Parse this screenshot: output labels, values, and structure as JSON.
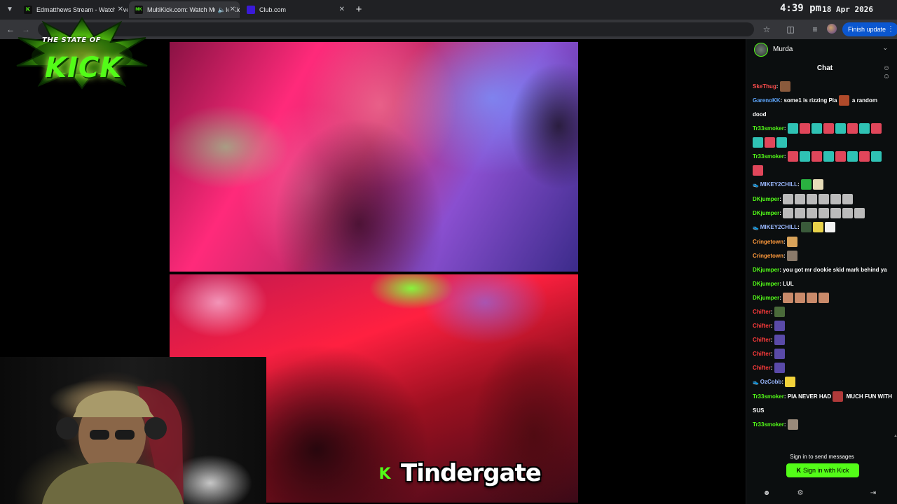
{
  "browser": {
    "tabs": [
      {
        "title": "Edmatthews Stream - Watch Live on Kick",
        "favicon": "K",
        "favicon_color": "#53fc18",
        "active": false
      },
      {
        "title": "MultiKick.com: Watch Multiple Kick Streams",
        "favicon": "MK",
        "favicon_color": "#53fc18",
        "active": true
      },
      {
        "title": "Club.com",
        "favicon": "",
        "favicon_color": "#3a1ad8",
        "active": false
      }
    ],
    "clock": "4:39 pm",
    "date": "18 Apr 2026",
    "finish_update_label": "Finish update"
  },
  "logo": {
    "line1": "THE STATE OF",
    "line2": "KICK"
  },
  "caption": {
    "icon": "K",
    "text": "Tindergate"
  },
  "chat": {
    "channel_name": "Murda",
    "title": "Chat",
    "sign_in_prompt": "Sign in to send messages",
    "sign_in_button": "Sign in with Kick",
    "messages": [
      {
        "user": "SkeThug",
        "color": "#ff4d4d",
        "text": "",
        "emotes": [
          "#8a5a3c"
        ]
      },
      {
        "user": "GarenoKK",
        "color": "#5fa8ff",
        "text": "some1 is rizzing Pia",
        "text2": "a random dood",
        "emotes_mid": [
          "#b04a2a"
        ]
      },
      {
        "user": "Tr33smoker",
        "color": "#53fc18",
        "text": "",
        "emotes": [
          "#2fc2b4",
          "#e0465a",
          "#2fc2b4",
          "#e0465a",
          "#2fc2b4",
          "#e0465a",
          "#2fc2b4",
          "#e0465a",
          "#2fc2b4",
          "#e0465a",
          "#2fc2b4"
        ]
      },
      {
        "user": "Tr33smoker",
        "color": "#53fc18",
        "text": "",
        "emotes": [
          "#e0465a",
          "#2fc2b4",
          "#e0465a",
          "#2fc2b4",
          "#e0465a",
          "#2fc2b4",
          "#e0465a",
          "#2fc2b4",
          "#e0465a"
        ]
      },
      {
        "user": "MIKEY2CHILL",
        "color": "#9ab8ff",
        "badge": "👟",
        "text": "",
        "emotes": [
          "#2ab040",
          "#e6dcb8"
        ]
      },
      {
        "user": "DKjumper",
        "color": "#53fc18",
        "text": "",
        "emotes": [
          "#bbbbbb",
          "#bbbbbb",
          "#bbbbbb",
          "#bbbbbb",
          "#bbbbbb",
          "#bbbbbb"
        ]
      },
      {
        "user": "DKjumper",
        "color": "#53fc18",
        "text": "",
        "emotes": [
          "#bbbbbb",
          "#bbbbbb",
          "#bbbbbb",
          "#bbbbbb",
          "#bbbbbb",
          "#bbbbbb",
          "#bbbbbb"
        ]
      },
      {
        "user": "MIKEY2CHILL",
        "color": "#9ab8ff",
        "badge": "👟",
        "text": "",
        "emotes": [
          "#3a5a3a",
          "#e8d24a",
          "#f2f2f2"
        ]
      },
      {
        "user": "Cringetown",
        "color": "#ff9a3c",
        "text": "",
        "emotes": [
          "#d9a35a"
        ]
      },
      {
        "user": "Cringetown",
        "color": "#ff9a3c",
        "text": "",
        "emotes": [
          "#8a7a6a"
        ]
      },
      {
        "user": "DKjumper",
        "color": "#53fc18",
        "text": "you got mr dookie skid mark behind ya",
        "emotes": []
      },
      {
        "user": "DKjumper",
        "color": "#53fc18",
        "text": "LUL",
        "emotes": []
      },
      {
        "user": "DKjumper",
        "color": "#53fc18",
        "text": "",
        "emotes": [
          "#c98a6a",
          "#c98a6a",
          "#c98a6a",
          "#c98a6a"
        ]
      },
      {
        "user": "Chifter",
        "color": "#ff3b3b",
        "text": "",
        "emotes": [
          "#4a6a3a"
        ]
      },
      {
        "user": "Chifter",
        "color": "#ff3b3b",
        "text": "",
        "emotes": [
          "#5a4aa8"
        ]
      },
      {
        "user": "Chifter",
        "color": "#ff3b3b",
        "text": "",
        "emotes": [
          "#5a4aa8"
        ]
      },
      {
        "user": "Chifter",
        "color": "#ff3b3b",
        "text": "",
        "emotes": [
          "#5a4aa8"
        ]
      },
      {
        "user": "Chifter",
        "color": "#ff3b3b",
        "text": "",
        "emotes": [
          "#5a4aa8"
        ]
      },
      {
        "user": "OzCobb",
        "color": "#9ab8ff",
        "badge": "👟",
        "text": "",
        "emotes": [
          "#f2d23a"
        ]
      },
      {
        "user": "Tr33smoker",
        "color": "#53fc18",
        "text": "PIA NEVER HAD",
        "text2": "MUCH FUN WITH SUS",
        "emotes_mid": [
          "#b03a3a"
        ]
      },
      {
        "user": "Tr33smoker",
        "color": "#53fc18",
        "text": "",
        "emotes": [
          "#9a8a7a"
        ]
      }
    ]
  },
  "icons": {
    "tab_menu": "chevron-down-icon",
    "back": "arrow-left-icon",
    "forward": "arrow-right-icon",
    "bookmark": "star-icon",
    "extensions": "puzzle-icon",
    "media": "media-queue-icon",
    "close_tab": "close-icon",
    "mute": "speaker-icon",
    "chat_users": "users-icon",
    "foot_add_user": "add-user-icon",
    "foot_settings": "gear-icon",
    "foot_exit": "exit-icon"
  }
}
